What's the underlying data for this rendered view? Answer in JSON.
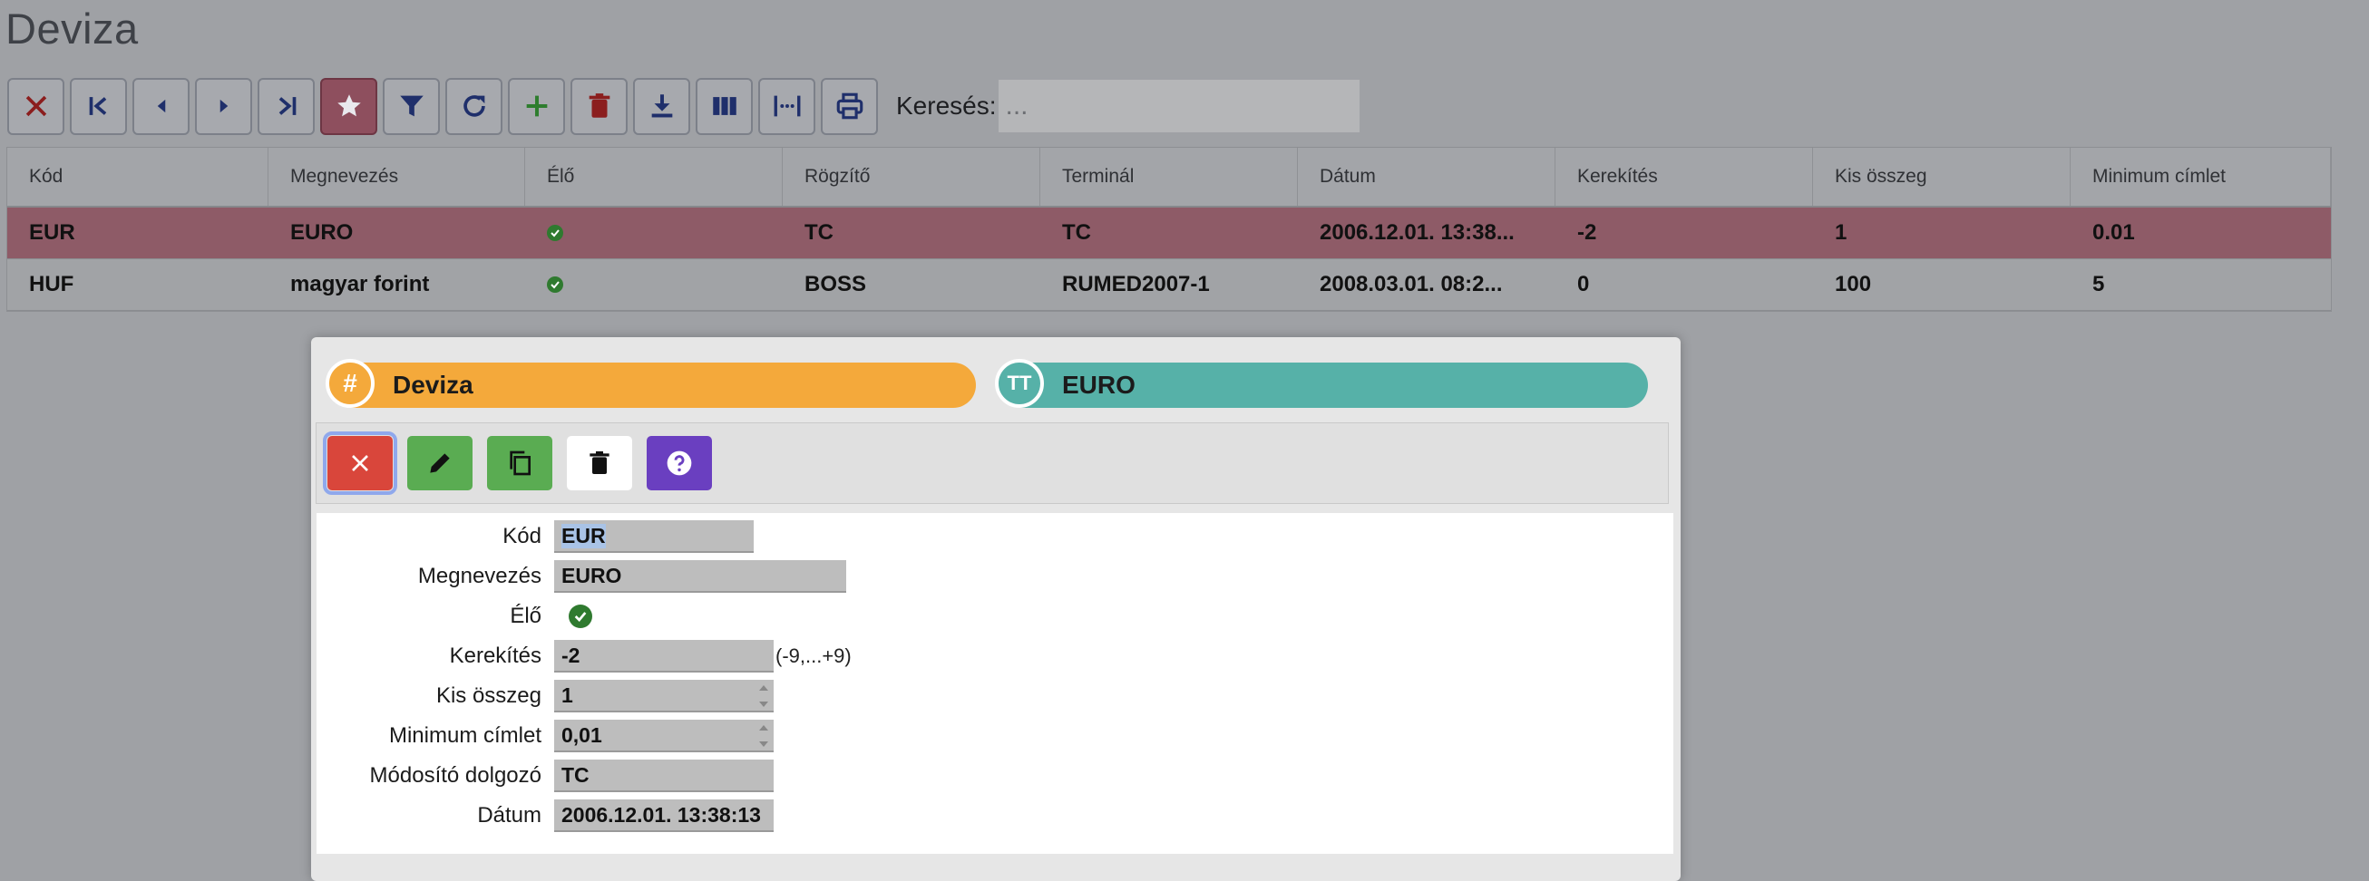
{
  "page": {
    "title": "Deviza"
  },
  "toolbar": {
    "search_label": "Keresés:",
    "search_placeholder": "...",
    "buttons": [
      "close-icon",
      "first-page-icon",
      "prev-icon",
      "next-icon",
      "last-page-icon",
      "star-icon",
      "filter-icon",
      "refresh-icon",
      "plus-icon",
      "trash-icon",
      "download-icon",
      "columns-icon",
      "fit-width-icon",
      "print-icon"
    ]
  },
  "grid": {
    "columns": [
      "Kód",
      "Megnevezés",
      "Élő",
      "Rögzítő",
      "Terminál",
      "Dátum",
      "Kerekítés",
      "Kis összeg",
      "Minimum címlet"
    ],
    "rows": [
      {
        "kod": "EUR",
        "megnevezes": "EURO",
        "elo": true,
        "rogzito": "TC",
        "terminal": "TC",
        "datum": "2006.12.01. 13:38...",
        "kerekites": "-2",
        "kis_osszeg": "1",
        "minimum_cimlet": "0.01"
      },
      {
        "kod": "HUF",
        "megnevezes": "magyar forint",
        "elo": true,
        "rogzito": "BOSS",
        "terminal": "RUMED2007-1",
        "datum": "2008.03.01. 08:2...",
        "kerekites": "0",
        "kis_osszeg": "100",
        "minimum_cimlet": "5"
      }
    ]
  },
  "dialog": {
    "header_left": "Deviza",
    "header_right": "EURO",
    "header_right_icon_text": "TT",
    "form": {
      "labels": {
        "kod": "Kód",
        "megnevezes": "Megnevezés",
        "elo": "Élő",
        "kerekites": "Kerekítés",
        "kis_osszeg": "Kis összeg",
        "minimum_cimlet": "Minimum címlet",
        "modosito": "Módosító dolgozó",
        "datum": "Dátum"
      },
      "values": {
        "kod": "EUR",
        "megnevezes": "EURO",
        "kerekites": "-2",
        "kerekites_hint": "(-9,...+9)",
        "kis_osszeg": "1",
        "minimum_cimlet": "0,01",
        "modosito": "TC",
        "datum": "2006.12.01. 13:38:13"
      }
    }
  },
  "colors": {
    "selected_row": "#8e5b67",
    "orange": "#f4a93b",
    "teal": "#56b1a8",
    "danger": "#d9463b",
    "success": "#5aac52",
    "purple": "#6a3fc0"
  }
}
